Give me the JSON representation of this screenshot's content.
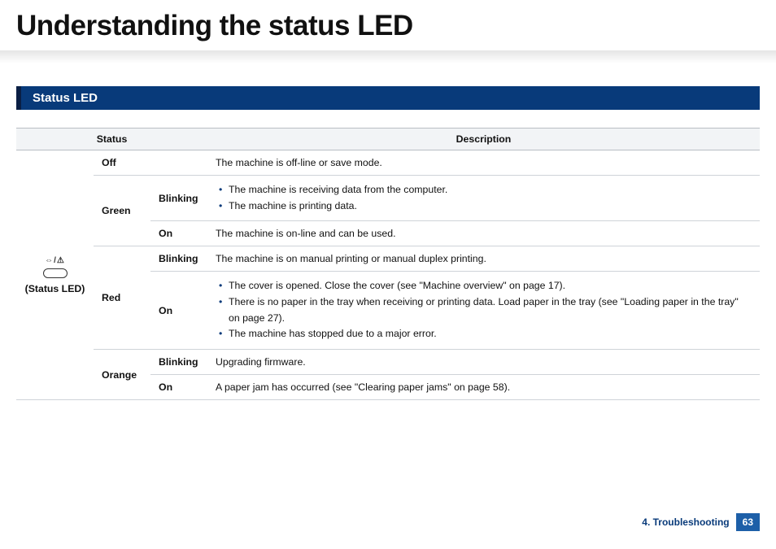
{
  "page": {
    "title": "Understanding the status LED",
    "section": "Status LED"
  },
  "table": {
    "headers": {
      "status": "Status",
      "description": "Description"
    },
    "status_label": "(Status LED)",
    "off": {
      "label": "Off",
      "desc": "The machine is off-line or save mode."
    },
    "green": {
      "label": "Green",
      "blinking": {
        "label": "Blinking",
        "items": [
          "The machine is receiving data from the computer.",
          "The machine is printing data."
        ]
      },
      "on": {
        "label": "On",
        "desc": "The machine is on-line and can be used."
      }
    },
    "red": {
      "label": "Red",
      "blinking": {
        "label": "Blinking",
        "desc": "The machine is on manual printing or manual duplex printing."
      },
      "on": {
        "label": "On",
        "items": [
          "The cover is opened. Close the cover (see \"Machine overview\" on page 17).",
          "There is no paper in the tray when receiving or printing data. Load paper in the tray (see \"Loading paper in the tray\" on page 27).",
          "The machine has stopped due to a major error."
        ]
      }
    },
    "orange": {
      "label": "Orange",
      "blinking": {
        "label": "Blinking",
        "desc": "Upgrading firmware."
      },
      "on": {
        "label": "On",
        "desc": "A paper jam has occurred (see \"Clearing paper jams\" on page 58)."
      }
    }
  },
  "footer": {
    "chapter": "4. Troubleshooting",
    "page": "63"
  }
}
